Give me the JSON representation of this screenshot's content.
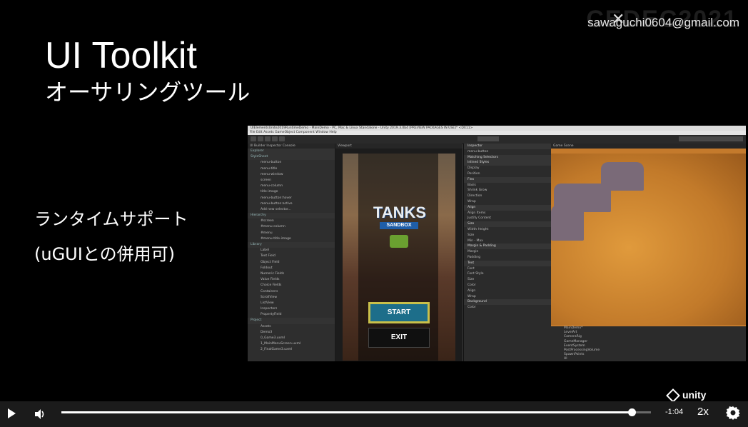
{
  "slide": {
    "email_overlay": "sawaguchi0604@gmail.com",
    "event_logo": "CEDEC2021",
    "title": "UI Toolkit",
    "subtitle": "オーサリングツール",
    "bullets": [
      "ランタイムサポート",
      "(uGUIとの併用可)"
    ],
    "unity_logo": "unity"
  },
  "editor": {
    "window_title": "UIElementsUnite2019RuntimeDemo - MainDemo - PC, Mac & Linux Standalone - Unity 2019.3.0b4 [PREVIEW PACKAGES IN USE]* <DX11>",
    "menu": "File  Edit  Assets  GameObject  Component  Window  Help",
    "ui_builder_tab": "UI Builder",
    "inspector_tab": "Inspector",
    "console_tab": "Console",
    "explorer_label": "Explorer",
    "stylesheet_items": [
      "StyleSheet",
      "menu-button",
      "menu-title",
      "menu-window",
      "screen",
      "menu-column",
      "title-image",
      "menu-button:hover",
      "menu-button:active",
      "Add new selector..."
    ],
    "hierarchy_items": [
      "Hierarchy",
      "#screen",
      "#menu-column",
      "#menu",
      "#menu-title-image"
    ],
    "library_items": [
      "Library",
      "Label",
      "Text Field",
      "Object Field",
      "Foldout",
      "Numeric Fields",
      "Value Fields",
      "Choice Fields",
      "Containers",
      "ScrollView",
      "ListView",
      "Inspectors",
      "PropertyField",
      "Project",
      "Assets",
      "Demo3",
      "0_Game3.uxml",
      "1_MainMenuScreen.uxml",
      "2_FinalGame3.uxml"
    ],
    "viewport_label": "Viewport",
    "game_logo": "TANKS",
    "game_sub": "SANDBOX",
    "start_label": "START",
    "exit_label": "EXIT",
    "inspector_rows": [
      "Inspector",
      "menu-button",
      "Matching Selectors",
      "Inlined Styles",
      "Display",
      "Position",
      "Flex",
      "Basis",
      "Shrink  Grow",
      "Direction",
      "Wrap",
      "Align",
      "Align Items",
      "Justify Content",
      "Size",
      "Width  Height",
      "Size",
      "Min - Max",
      "Margin & Padding",
      "Margin",
      "Padding",
      "Text",
      "Font",
      "Font Style",
      "Size",
      "Color",
      "Align",
      "Wrap",
      "Background",
      "Color"
    ],
    "game_tab": "Game",
    "scene_tab": "Scene",
    "hierarchy_tree": [
      "MainDemo*",
      "LevelArt",
      "CameraRig",
      "GameManager",
      "EventSystem",
      "PostProcessingVolume",
      "SpawnPoints",
      "UI"
    ]
  },
  "player": {
    "time_remaining": "-1:04",
    "speed": "2x",
    "progress": 0.967
  },
  "colors": {
    "start_button": "#1d6e8a",
    "start_border": "#c9c04a",
    "sandbox_banner": "#1f5ea8"
  }
}
